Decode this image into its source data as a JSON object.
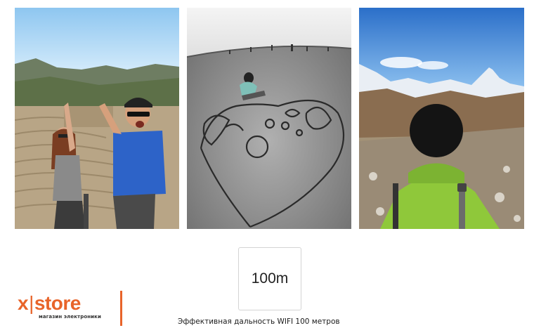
{
  "product": {
    "range_label": "100m",
    "caption": "Эффективная дальность WIFI 100 метров"
  },
  "photos": [
    {
      "icon": "selfie-ancient-theater-photo"
    },
    {
      "icon": "sand-drawing-bw-photo"
    },
    {
      "icon": "mountain-selfie-photo"
    }
  ],
  "brand": {
    "name_x": "x",
    "name_sep": "|",
    "name_store": "store",
    "tagline": "магазин электроники",
    "accent_color": "#e8642a"
  }
}
